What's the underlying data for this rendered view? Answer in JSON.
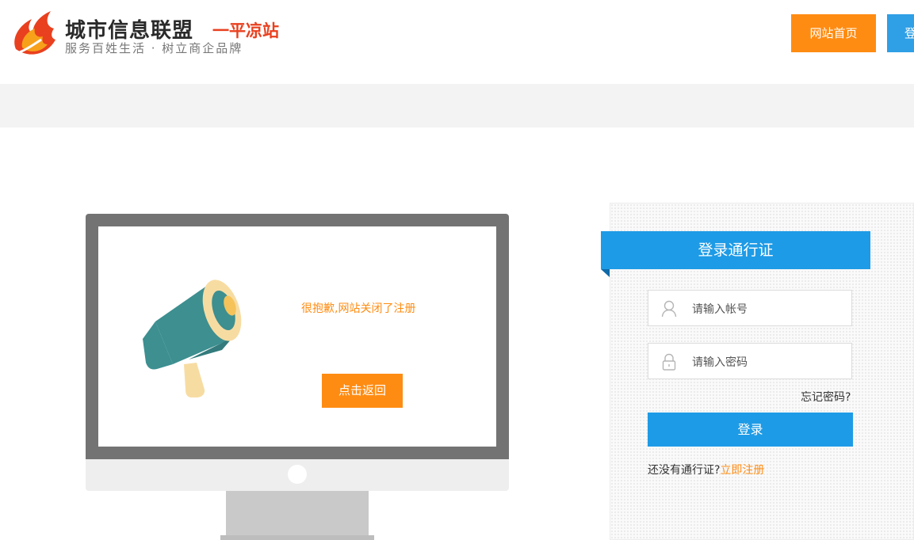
{
  "header": {
    "logo_title": "城市信息联盟",
    "logo_city": "一平凉站",
    "logo_slogan": "服务百姓生活 · 树立商企品牌",
    "home_button": "网站首页",
    "login_button": "登"
  },
  "notice": {
    "message": "很抱歉,网站关闭了注册",
    "back_button": "点击返回"
  },
  "login": {
    "title": "登录通行证",
    "username_placeholder": "请输入帐号",
    "password_placeholder": "请输入密码",
    "forgot": "忘记密码?",
    "submit": "登录",
    "no_account": "还没有通行证?",
    "register": "立即注册"
  },
  "icons": {
    "logo": "flame-logo-icon",
    "megaphone": "megaphone-icon",
    "user": "user-icon",
    "lock": "lock-icon"
  },
  "colors": {
    "orange": "#ff8c12",
    "blue": "#1e9be6",
    "logo_red": "#e9401f"
  }
}
